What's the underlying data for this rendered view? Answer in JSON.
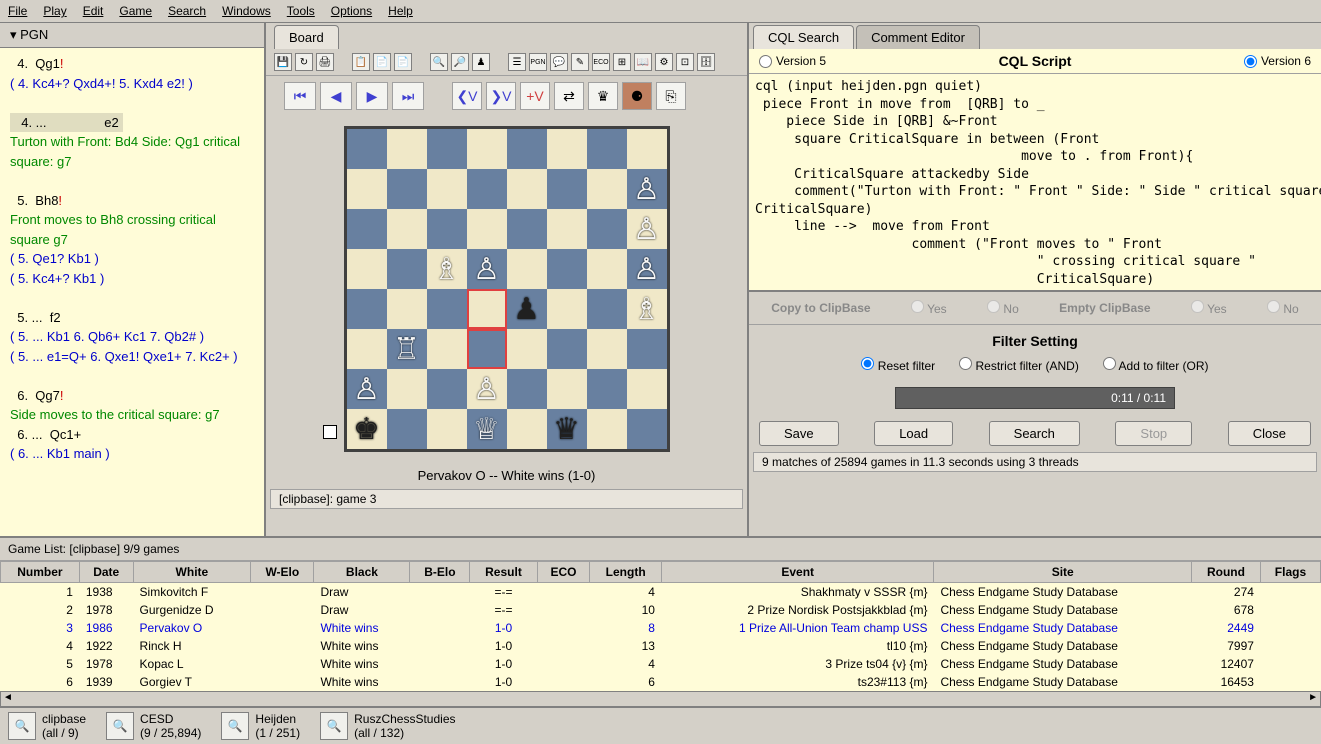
{
  "menu": {
    "file": "File",
    "play": "Play",
    "edit": "Edit",
    "game": "Game",
    "search": "Search",
    "windows": "Windows",
    "tools": "Tools",
    "options": "Options",
    "help": "Help"
  },
  "pgn": {
    "tab": "▾ PGN",
    "lines": [
      {
        "t": "mv",
        "n": "4.",
        "m": "Qg1",
        "excl": "!"
      },
      {
        "t": "blue",
        "txt": "( 4. Kc4+? Qxd4+! 5. Kxd4 e2! )"
      },
      {
        "t": "sp"
      },
      {
        "t": "hl",
        "n": "4. ...",
        "m": "e2"
      },
      {
        "t": "green",
        "txt": "Turton with Front: Bd4 Side: Qg1 critical square: g7"
      },
      {
        "t": "sp"
      },
      {
        "t": "mv",
        "n": "5.",
        "m": "Bh8",
        "excl": "!"
      },
      {
        "t": "green",
        "txt": "Front moves to Bh8 crossing critical square g7"
      },
      {
        "t": "blue",
        "txt": "( 5. Qe1? Kb1 )"
      },
      {
        "t": "blue",
        "txt": "( 5. Kc4+? Kb1 )"
      },
      {
        "t": "sp"
      },
      {
        "t": "mv",
        "n": "5. ...",
        "m": "f2"
      },
      {
        "t": "blue",
        "txt": "( 5. ... Kb1 6. Qb6+ Kc1 7. Qb2# )"
      },
      {
        "t": "blue",
        "txt": "( 5. ... e1=Q+ 6. Qxe1! Qxe1+ 7. Kc2+ )"
      },
      {
        "t": "sp"
      },
      {
        "t": "mv",
        "n": "6.",
        "m": "Qg7",
        "excl": "!"
      },
      {
        "t": "green",
        "txt": "Side moves to the critical square: g7"
      },
      {
        "t": "mv",
        "n": "6. ...",
        "m": "Qc1+"
      },
      {
        "t": "blue",
        "txt": "( 6. ... Kb1 main )"
      }
    ]
  },
  "board": {
    "tab": "Board",
    "caption": "Pervakov O  --  White wins  (1-0)",
    "status": "[clipbase]: game  3"
  },
  "cql": {
    "tab1": "CQL Search",
    "tab2": "Comment Editor",
    "v5": "Version 5",
    "v6": "Version 6",
    "title": "CQL Script",
    "script": "cql (input heijden.pgn quiet)\n piece Front in move from  [QRB] to _\n    piece Side in [QRB] &~Front\n     square CriticalSquare in between (Front\n                                  move to . from Front){\n     CriticalSquare attackedby Side\n     comment(\"Turton with Front: \" Front \" Side: \" Side \" critical square: \"\nCriticalSquare)\n     line -->  move from Front\n                    comment (\"Front moves to \" Front\n                                    \" crossing critical square \"\n                                    CriticalSquare)",
    "copy_lbl": "Copy to ClipBase",
    "empty_lbl": "Empty ClipBase",
    "yes": "Yes",
    "no": "No",
    "filter_title": "Filter Setting",
    "f1": "Reset filter",
    "f2": "Restrict filter (AND)",
    "f3": "Add to filter (OR)",
    "progress": "0:11 / 0:11",
    "save": "Save",
    "load": "Load",
    "search": "Search",
    "stop": "Stop",
    "close": "Close",
    "status": "9 matches of 25894 games in 11.3 seconds using 3 threads"
  },
  "gamelist": {
    "header": "Game List: [clipbase] 9/9 games",
    "cols": [
      "Number",
      "Date",
      "White",
      "W-Elo",
      "Black",
      "B-Elo",
      "Result",
      "ECO",
      "Length",
      "Event",
      "Site",
      "Round",
      "Flags"
    ],
    "rows": [
      {
        "n": "1",
        "date": "1938",
        "white": "Simkovitch F",
        "black": "Draw",
        "result": "=-=",
        "len": "4",
        "event": "Shakhmaty v SSSR {m}",
        "site": "Chess Endgame Study Database",
        "round": "274"
      },
      {
        "n": "2",
        "date": "1978",
        "white": "Gurgenidze D",
        "black": "Draw",
        "result": "=-=",
        "len": "10",
        "event": "2 Prize Nordisk Postsjakkblad {m}",
        "site": "Chess Endgame Study Database",
        "round": "678"
      },
      {
        "n": "3",
        "date": "1986",
        "white": "Pervakov O",
        "black": "White wins",
        "result": "1-0",
        "len": "8",
        "event": "1 Prize All-Union Team champ USS",
        "site": "Chess Endgame Study Database",
        "round": "2449",
        "sel": true
      },
      {
        "n": "4",
        "date": "1922",
        "white": "Rinck H",
        "black": "White wins",
        "result": "1-0",
        "len": "13",
        "event": "tl10 {m}",
        "site": "Chess Endgame Study Database",
        "round": "7997"
      },
      {
        "n": "5",
        "date": "1978",
        "white": "Kopac L",
        "black": "White wins",
        "result": "1-0",
        "len": "4",
        "event": "3 Prize ts04 {v} {m}",
        "site": "Chess Endgame Study Database",
        "round": "12407"
      },
      {
        "n": "6",
        "date": "1939",
        "white": "Gorgiev T",
        "black": "White wins",
        "result": "1-0",
        "len": "6",
        "event": "ts23#113 {m}",
        "site": "Chess Endgame Study Database",
        "round": "16453"
      }
    ]
  },
  "dbs": [
    {
      "name": "clipbase",
      "sub": "(all / 9)"
    },
    {
      "name": "CESD",
      "sub": "(9 / 25,894)"
    },
    {
      "name": "Heijden",
      "sub": "(1 / 251)"
    },
    {
      "name": "RuszChessStudies",
      "sub": "(all / 132)"
    }
  ]
}
